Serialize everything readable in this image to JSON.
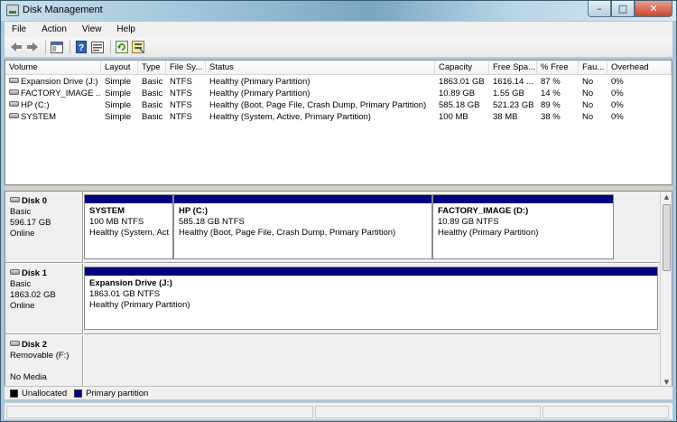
{
  "window": {
    "title": "Disk Management"
  },
  "caption": {
    "minimize": "–",
    "maximize": "□",
    "close": "✕"
  },
  "menu": [
    "File",
    "Action",
    "View",
    "Help"
  ],
  "toolbar": {
    "back": "back-arrow-icon",
    "forward": "forward-arrow-icon",
    "pane": "show-pane-icon",
    "help": "help-icon",
    "properties": "properties-icon",
    "refresh": "refresh-icon",
    "rescan": "rescan-disks-icon"
  },
  "volume_list": {
    "columns": [
      "Volume",
      "Layout",
      "Type",
      "File Sy...",
      "Status",
      "Capacity",
      "Free Spa...",
      "% Free",
      "Fau...",
      "Overhead"
    ],
    "rows": [
      [
        "Expansion Drive (J:)",
        "Simple",
        "Basic",
        "NTFS",
        "Healthy (Primary Partition)",
        "1863.01 GB",
        "1616.14 ...",
        "87 %",
        "No",
        "0%"
      ],
      [
        "FACTORY_IMAGE ...",
        "Simple",
        "Basic",
        "NTFS",
        "Healthy (Primary Partition)",
        "10.89 GB",
        "1.55 GB",
        "14 %",
        "No",
        "0%"
      ],
      [
        "HP (C:)",
        "Simple",
        "Basic",
        "NTFS",
        "Healthy (Boot, Page File, Crash Dump, Primary Partition)",
        "585.18 GB",
        "521.23 GB",
        "89 %",
        "No",
        "0%"
      ],
      [
        "SYSTEM",
        "Simple",
        "Basic",
        "NTFS",
        "Healthy (System, Active, Primary Partition)",
        "100 MB",
        "38 MB",
        "38 %",
        "No",
        "0%"
      ]
    ]
  },
  "disks": [
    {
      "name": "Disk 0",
      "type": "Basic",
      "size": "596.17 GB",
      "state": "Online",
      "partitions": [
        {
          "name": "SYSTEM",
          "size": "100 MB NTFS",
          "status": "Healthy (System, Act"
        },
        {
          "name": "HP  (C:)",
          "size": "585.18 GB NTFS",
          "status": "Healthy (Boot, Page File, Crash Dump, Primary Partition)"
        },
        {
          "name": "FACTORY_IMAGE  (D:)",
          "size": "10.89 GB NTFS",
          "status": "Healthy (Primary Partition)"
        }
      ]
    },
    {
      "name": "Disk 1",
      "type": "Basic",
      "size": "1863.02 GB",
      "state": "Online",
      "partitions": [
        {
          "name": "Expansion Drive  (J:)",
          "size": "1863.01 GB NTFS",
          "status": "Healthy (Primary Partition)"
        }
      ]
    },
    {
      "name": "Disk 2",
      "type": "Removable (F:)",
      "size": "",
      "state": "No Media",
      "partitions": []
    }
  ],
  "legend": [
    {
      "label": "Unallocated",
      "color": "#000000"
    },
    {
      "label": "Primary partition",
      "color": "#000080"
    }
  ],
  "colors": {
    "primary_partition": "#000080",
    "unallocated": "#000000"
  }
}
